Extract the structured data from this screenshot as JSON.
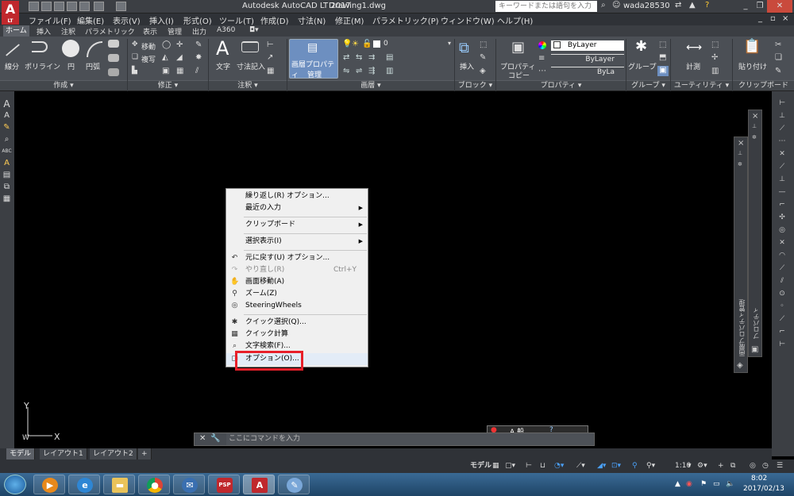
{
  "window": {
    "app_title": "Autodesk AutoCAD LT 2017",
    "file_title": "Drawing1.dwg",
    "search_placeholder": "キーワードまたは語句を入力",
    "user_name": "wada28530",
    "logo_text": "A",
    "logo_sub": "LT"
  },
  "menu": [
    "ファイル(F)",
    "編集(E)",
    "表示(V)",
    "挿入(I)",
    "形式(O)",
    "ツール(T)",
    "作成(D)",
    "寸法(N)",
    "修正(M)",
    "パラメトリック(P)",
    "ウィンドウ(W)",
    "ヘルプ(H)"
  ],
  "ribbon_tabs": [
    "ホーム",
    "挿入",
    "注釈",
    "パラメトリック",
    "表示",
    "管理",
    "出力",
    "A360"
  ],
  "ribbon": {
    "draw_tools": [
      "線分",
      "ポリライン",
      "円",
      "円弧"
    ],
    "modify_tools": [
      "移動",
      "複写"
    ],
    "text_tool": "文字",
    "dim_tool": "寸法記入",
    "layer_props": [
      "画層プロパティ",
      "管理"
    ],
    "layer_value": "0",
    "insert_tool": "挿入",
    "prop_copy": [
      "プロパティ",
      "コピー"
    ],
    "bylayer_1": "ByLayer",
    "bylayer_2": "ByLayer",
    "bylayer_3": "ByLa",
    "group_tool": "グループ",
    "measure_tool": "計測",
    "paste_tool": "貼り付け",
    "panels": [
      "作成 ▾",
      "修正 ▾",
      "注釈 ▾",
      "画層 ▾",
      "ブロック ▾",
      "プロパティ ▾",
      "グループ ▾",
      "ユーティリティ ▾",
      "クリップボード"
    ]
  },
  "context_menu": {
    "items": [
      {
        "label": "繰り返し(R) オプション...",
        "submenu": false,
        "shortcut": "",
        "disabled": false
      },
      {
        "label": "最近の入力",
        "submenu": true,
        "shortcut": "",
        "disabled": false
      },
      {
        "label": "クリップボード",
        "submenu": true,
        "shortcut": "",
        "disabled": false
      },
      {
        "label": "選択表示(I)",
        "submenu": true,
        "shortcut": "",
        "disabled": false
      },
      {
        "label": "元に戻す(U) オプション...",
        "submenu": false,
        "shortcut": "",
        "disabled": false
      },
      {
        "label": "やり直し(R)",
        "submenu": false,
        "shortcut": "Ctrl+Y",
        "disabled": true
      },
      {
        "label": "画面移動(A)",
        "submenu": false,
        "shortcut": "",
        "disabled": false
      },
      {
        "label": "ズーム(Z)",
        "submenu": false,
        "shortcut": "",
        "disabled": false
      },
      {
        "label": "SteeringWheels",
        "submenu": false,
        "shortcut": "",
        "disabled": false
      },
      {
        "label": "クイック選択(Q)...",
        "submenu": false,
        "shortcut": "",
        "disabled": false
      },
      {
        "label": "クイック計算",
        "submenu": false,
        "shortcut": "",
        "disabled": false
      },
      {
        "label": "文字検索(F)...",
        "submenu": false,
        "shortcut": "",
        "disabled": false
      },
      {
        "label": "オプション(O)...",
        "submenu": false,
        "shortcut": "",
        "disabled": false
      }
    ]
  },
  "palettes": {
    "properties": "プロパティ",
    "layer_manager": "画層プロパティ管理"
  },
  "command_line": {
    "placeholder": "ここにコマンドを入力"
  },
  "ime": {
    "mode": "A 般"
  },
  "ucs": {
    "x": "X",
    "y": "Y",
    "w": "W"
  },
  "layout_tabs": [
    "モデル",
    "レイアウト1",
    "レイアウト2",
    "+"
  ],
  "status_bar": {
    "model": "モデル",
    "scale": "1:10"
  },
  "taskbar": {
    "time": "8:02",
    "date": "2017/02/13",
    "psp_label": "PSP"
  },
  "colors": {
    "highlight": "#e8202a",
    "logo": "#c0282d",
    "ribbon_bg": "#4b4f55"
  }
}
